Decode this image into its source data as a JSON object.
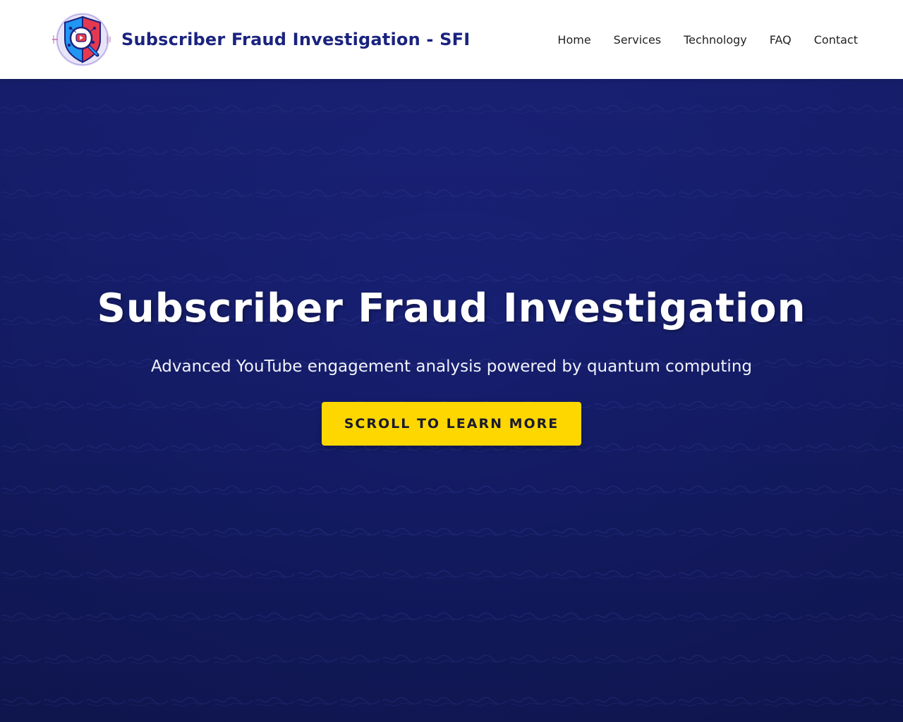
{
  "header": {
    "logo_icon": "shield-magnifier-youtube-icon",
    "brand_title": "Subscriber Fraud Investigation - SFI"
  },
  "nav": {
    "items": [
      "Home",
      "Services",
      "Technology",
      "FAQ",
      "Contact"
    ]
  },
  "hero": {
    "title": "Subscriber Fraud Investigation",
    "subtitle": "Advanced YouTube engagement analysis powered by quantum computing",
    "cta_label": "SCROLL TO LEARN MORE"
  },
  "colors": {
    "header_bg": "#ffffff",
    "brand_text": "#1a237e",
    "hero_bg": "#1a237e",
    "cta_bg": "#ffd700",
    "cta_text": "#1a1a2e"
  }
}
